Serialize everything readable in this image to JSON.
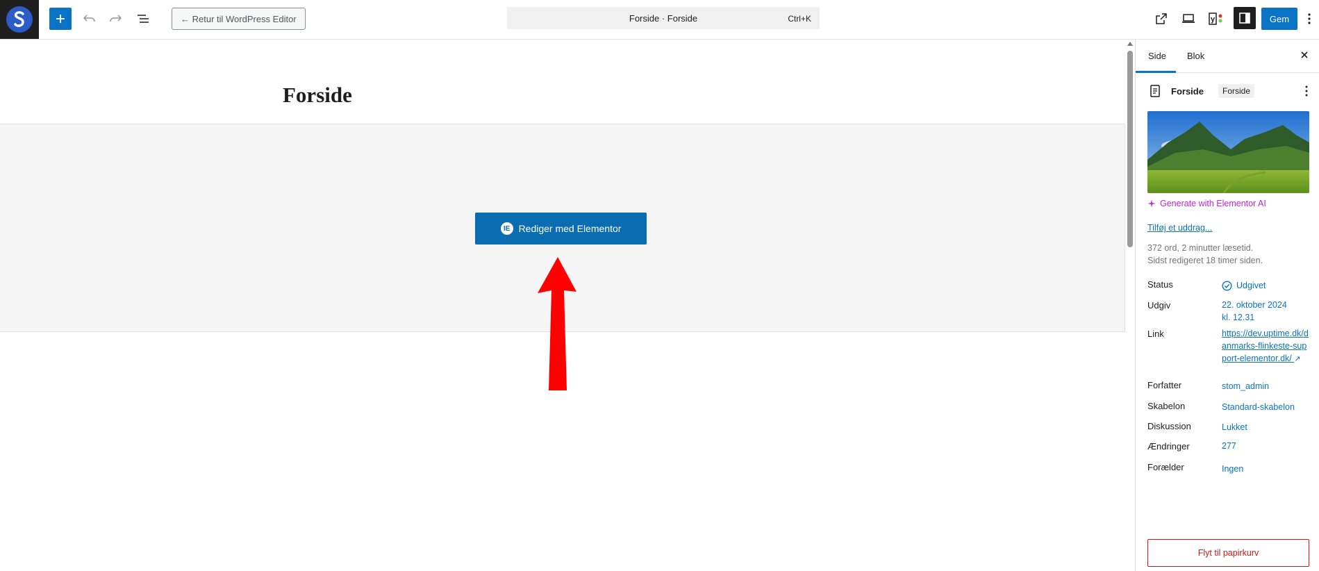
{
  "topbar": {
    "back_label": "← Retur til WordPress Editor",
    "command_title": "Forside · Forside",
    "command_shortcut": "Ctrl+K",
    "save_label": "Gem"
  },
  "canvas": {
    "page_title": "Forside",
    "elementor_button": "Rediger med Elementor"
  },
  "sidebar": {
    "tabs": [
      "Side",
      "Blok"
    ],
    "active_tab": "Side",
    "doc_title": "Forside",
    "doc_badge": "Forside",
    "generate_ai": "Generate with Elementor AI",
    "excerpt_link": "Tilføj et uddrag...",
    "word_count": "372 ord, 2 minutter læsetid.",
    "last_edited": "Sidst redigeret 18 timer siden.",
    "props": {
      "status_label": "Status",
      "status_value": "Udgivet",
      "publish_label": "Udgiv",
      "publish_date": "22. oktober 2024",
      "publish_time": "kl. 12.31",
      "link_label": "Link",
      "link_value": "https://dev.uptime.dk/danmarks-flinkeste-support-elementor.dk/",
      "link_arrow": "↗",
      "author_label": "Forfatter",
      "author_value": "stom_admin",
      "template_label": "Skabelon",
      "template_value": "Standard-skabelon",
      "discussion_label": "Diskussion",
      "discussion_value": "Lukket",
      "revisions_label": "Ændringer",
      "revisions_value": "277",
      "parent_label": "Forælder",
      "parent_value": "Ingen"
    },
    "trash_label": "Flyt til papirkurv"
  },
  "colors": {
    "accent": "#0a73c5",
    "elementor_button": "#0a6db2",
    "ai_magenta": "#c026d3",
    "danger": "#cc1818",
    "annotation_arrow": "#ff0000"
  },
  "icons": [
    "site-logo-icon",
    "plus-icon",
    "undo-icon",
    "redo-icon",
    "list-view-icon",
    "external-view-icon",
    "desktop-preview-icon",
    "yoast-icon",
    "sidebar-toggle-icon",
    "more-vertical-icon",
    "close-icon",
    "page-icon",
    "sparkle-icon",
    "check-circle-icon",
    "elementor-icon"
  ]
}
